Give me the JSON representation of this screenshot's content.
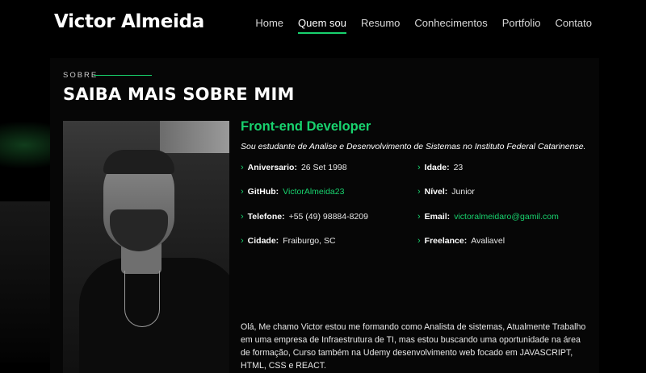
{
  "header": {
    "brand": "Victor Almeida",
    "nav": [
      "Home",
      "Quem sou",
      "Resumo",
      "Conhecimentos",
      "Portfolio",
      "Contato"
    ],
    "active_nav": "Quem sou"
  },
  "about": {
    "eyebrow": "SOBRE",
    "title": "SAIBA MAIS SOBRE MIM",
    "role": "Front-end Developer",
    "lead": "Sou estudante de Analise e Desenvolvimento de Sistemas no Instituto Federal Catarinense.",
    "facts": {
      "birthday": {
        "label": "Aniversario:",
        "value": "26 Set 1998"
      },
      "age": {
        "label": "Idade:",
        "value": "23"
      },
      "github": {
        "label": "GitHub:",
        "value": "VictorAlmeida23"
      },
      "level": {
        "label": "Nível:",
        "value": "Junior"
      },
      "phone": {
        "label": "Telefone:",
        "value": "+55 (49) 98884-8209"
      },
      "email": {
        "label": "Email:",
        "value": "victoralmeidaro@gamil.com"
      },
      "city": {
        "label": "Cidade:",
        "value": "Fraiburgo, SC"
      },
      "freelance": {
        "label": "Freelance:",
        "value": "Avaliavel"
      }
    },
    "bio": "Olá, Me chamo Victor estou me formando como Analista de sistemas, Atualmente Trabalho em uma empresa de Infraestrutura de TI, mas estou buscando uma oportunidade na área de formação, Curso também na Udemy desenvolvimento web focado em JAVASCRIPT, HTML, CSS e REACT."
  },
  "colors": {
    "accent": "#18d26e",
    "background": "#000000"
  },
  "icons": {
    "fact_bullet": "chevron-right-icon"
  }
}
